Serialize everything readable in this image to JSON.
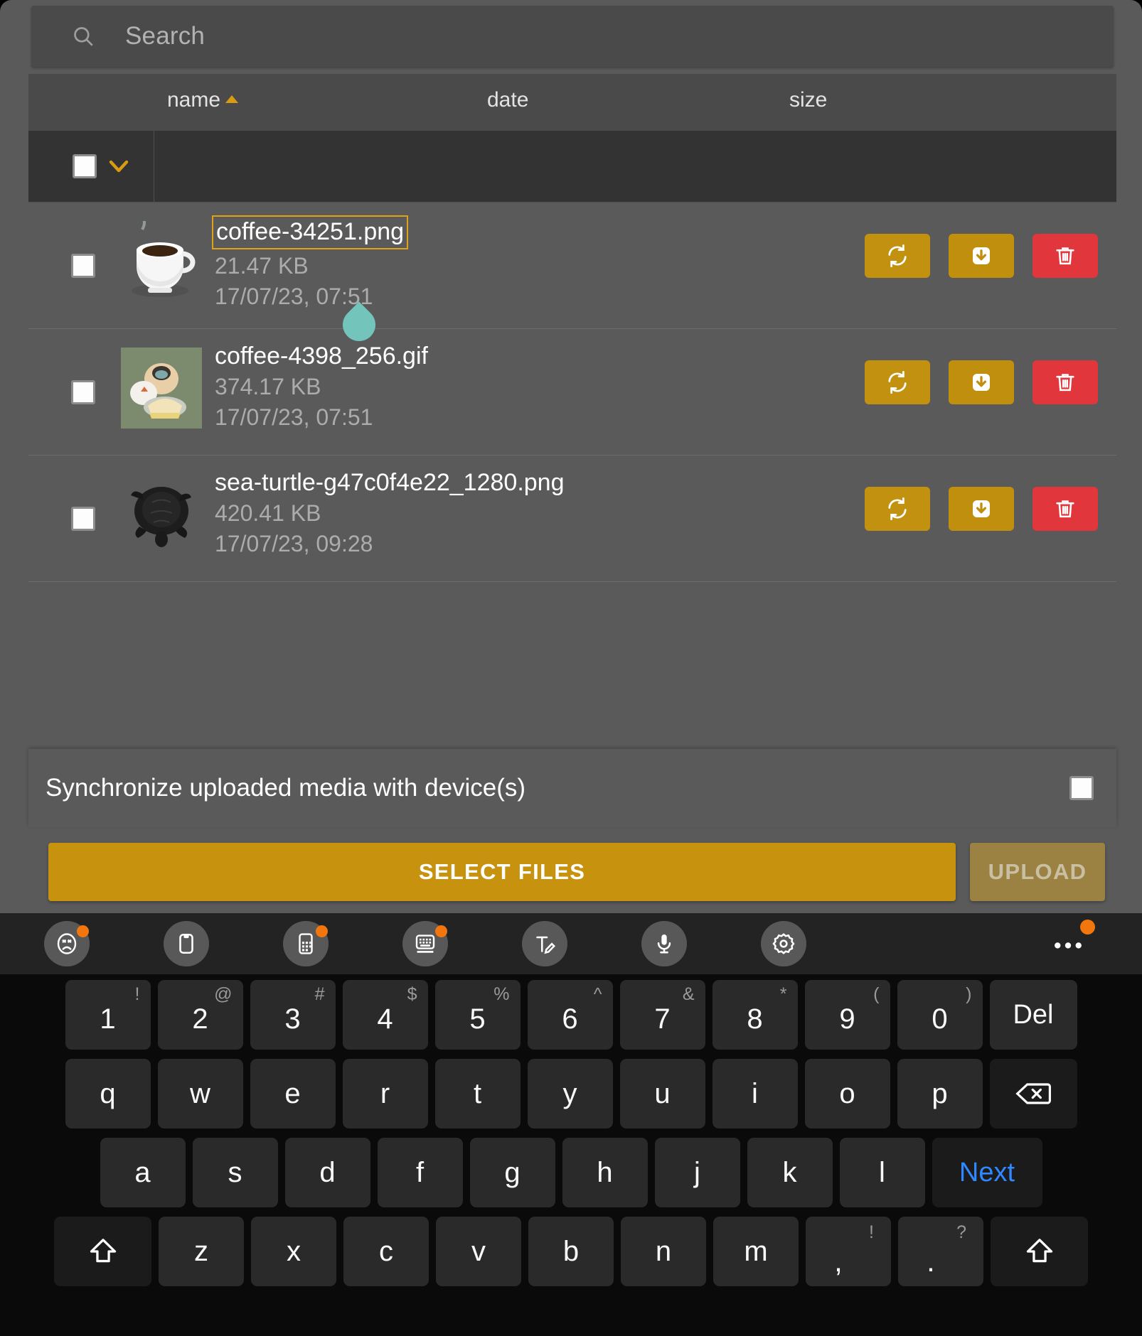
{
  "search": {
    "placeholder": "Search",
    "icon": "search-icon",
    "value": ""
  },
  "table": {
    "columns": [
      {
        "label": "name",
        "sorted": true,
        "direction": "asc"
      },
      {
        "label": "date",
        "sorted": false,
        "direction": ""
      },
      {
        "label": "size",
        "sorted": false,
        "direction": ""
      }
    ],
    "select_all_checked": false,
    "rows": [
      {
        "name": "coffee-34251.png",
        "size": "21.47 KB",
        "date": "17/07/23, 07:51",
        "checked": false,
        "editing": true,
        "thumb": "coffee-cup"
      },
      {
        "name": "coffee-4398_256.gif",
        "size": "374.17 KB",
        "date": "17/07/23, 07:51",
        "checked": false,
        "editing": false,
        "thumb": "pastries"
      },
      {
        "name": "sea-turtle-g47c0f4e22_1280.png",
        "size": "420.41 KB",
        "date": "17/07/23, 09:28",
        "checked": false,
        "editing": false,
        "thumb": "sea-turtle"
      }
    ],
    "row_actions": [
      {
        "name": "sync-button",
        "icon": "sync-icon",
        "color": "#c39110"
      },
      {
        "name": "download-button",
        "icon": "download-icon",
        "color": "#bf8f0d"
      },
      {
        "name": "delete-button",
        "icon": "trash-icon",
        "color": "#e0363c"
      }
    ]
  },
  "sync": {
    "label": "Synchronize uploaded media with device(s)",
    "checked": false
  },
  "buttons": {
    "select_files": "SELECT FILES",
    "upload": "UPLOAD"
  },
  "colors": {
    "accent": "#c7920d",
    "accent_border": "#e0a116",
    "danger": "#e0363c",
    "caret_handle": "#73c5bc",
    "badge": "#f2760d",
    "next_key": "#2f88ff"
  },
  "keyboard_toolbar": {
    "items": [
      {
        "name": "emoji-icon",
        "badge": true
      },
      {
        "name": "clipboard-icon",
        "badge": false
      },
      {
        "name": "numpad-icon",
        "badge": true
      },
      {
        "name": "keyboard-layout-icon",
        "badge": true
      },
      {
        "name": "handwriting-icon",
        "badge": false
      },
      {
        "name": "microphone-icon",
        "badge": false
      },
      {
        "name": "gear-icon",
        "badge": false
      },
      {
        "name": "more-options-icon",
        "badge": true
      }
    ]
  },
  "keyboard": {
    "row_numbers": [
      {
        "main": "1",
        "sup": "!"
      },
      {
        "main": "2",
        "sup": "@"
      },
      {
        "main": "3",
        "sup": "#"
      },
      {
        "main": "4",
        "sup": "$"
      },
      {
        "main": "5",
        "sup": "%"
      },
      {
        "main": "6",
        "sup": "^"
      },
      {
        "main": "7",
        "sup": "&"
      },
      {
        "main": "8",
        "sup": "*"
      },
      {
        "main": "9",
        "sup": "("
      },
      {
        "main": "0",
        "sup": ")"
      },
      {
        "main": "Del",
        "sup": ""
      }
    ],
    "row_top": [
      "q",
      "w",
      "e",
      "r",
      "t",
      "y",
      "u",
      "i",
      "o",
      "p"
    ],
    "backspace": "backspace-icon",
    "row_home": [
      "a",
      "s",
      "d",
      "f",
      "g",
      "h",
      "j",
      "k",
      "l"
    ],
    "next_label": "Next",
    "row_bottom": [
      "z",
      "x",
      "c",
      "v",
      "b",
      "n",
      "m"
    ],
    "comma": {
      "main": ",",
      "sup": "!"
    },
    "period": {
      "main": ".",
      "sup": "?"
    },
    "shift_left": "shift-icon",
    "shift_right": "shift-icon"
  }
}
